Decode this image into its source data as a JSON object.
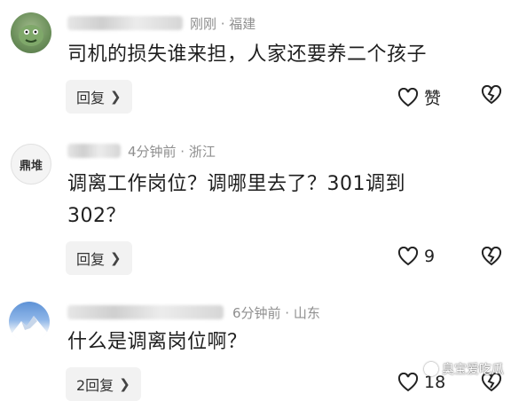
{
  "comments": [
    {
      "time_location": "刚刚 · 福建",
      "text": "司机的损失谁来担，人家还要养二个孩子",
      "reply_label": "回复",
      "like_label": "赞"
    },
    {
      "avatar_text": "鼎堆",
      "time_location": "4分钟前 · 浙江",
      "text_line1": "调离工作岗位？调哪里去了？301调到",
      "text_line2": "302？",
      "reply_label": "回复",
      "like_count": "9"
    },
    {
      "time_location": "6分钟前 · 山东",
      "text": "什么是调离岗位啊？",
      "reply_label": "2回复",
      "like_count": "18"
    }
  ],
  "watermark": "臭宝爱吃瓜",
  "icons": {
    "like": "heart-outline-icon",
    "dislike": "broken-heart-icon",
    "reply": "chevron-right-icon"
  }
}
